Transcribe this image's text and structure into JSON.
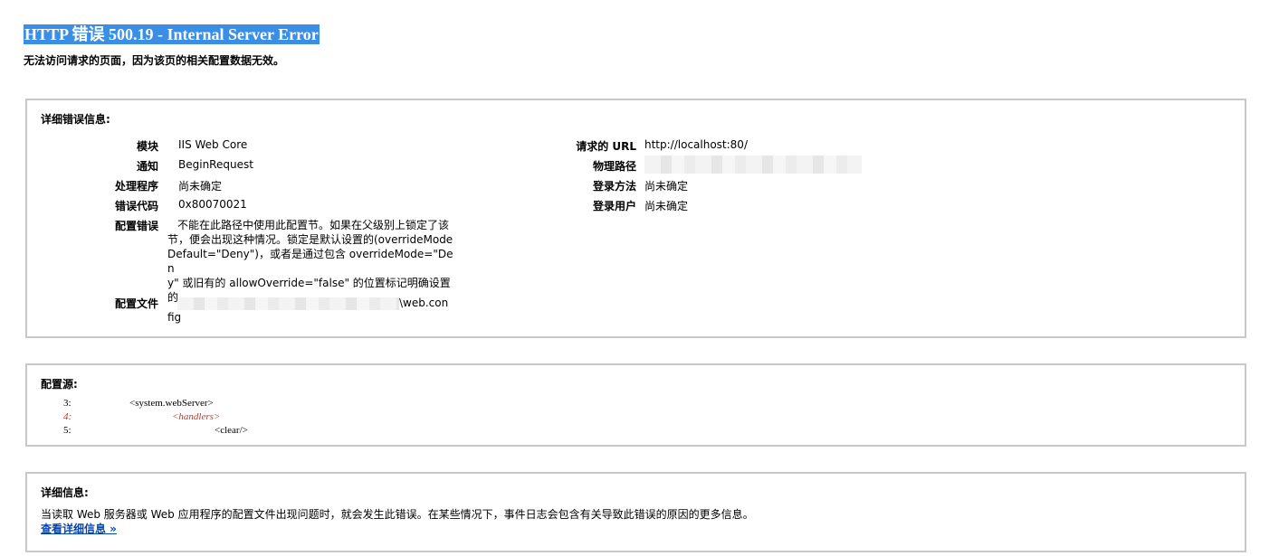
{
  "header": {
    "title": "HTTP 错误 500.19 - Internal Server Error",
    "subtitle": "无法访问请求的页面，因为该页的相关配置数据无效。"
  },
  "details": {
    "heading": "详细错误信息:",
    "left": [
      {
        "label": "模块",
        "value": "IIS Web Core"
      },
      {
        "label": "通知",
        "value": "BeginRequest"
      },
      {
        "label": "处理程序",
        "value": "尚未确定"
      },
      {
        "label": "错误代码",
        "value": "0x80070021"
      }
    ],
    "config_error": {
      "label": "配置错误",
      "lines": [
        "不能在此路径中使用此配置节。如果在父级别上锁定了该",
        "节，便会出现这种情况。锁定是默认设置的(overrideMode",
        "Default=\"Deny\")，或者是通过包含 overrideMode=\"Den",
        "y\" 或旧有的 allowOverride=\"false\" 的位置标记明确设置",
        "的。"
      ]
    },
    "config_file": {
      "label": "配置文件",
      "suffix": "\\web.con",
      "line2": "fig"
    },
    "right": [
      {
        "label": "请求的 URL",
        "value": "http://localhost:80/"
      },
      {
        "label": "物理路径",
        "value": ""
      },
      {
        "label": "登录方法",
        "value": "尚未确定"
      },
      {
        "label": "登录用户",
        "value": "尚未确定"
      }
    ]
  },
  "source": {
    "heading": "配置源:",
    "lines": [
      {
        "num": "3:",
        "text": "<system.webServer>",
        "indent": 0,
        "error": false
      },
      {
        "num": "4:",
        "text": "<handlers>",
        "indent": 1,
        "error": true
      },
      {
        "num": "5:",
        "text": "<clear/>",
        "indent": 2,
        "error": false
      }
    ]
  },
  "info": {
    "heading": "详细信息:",
    "text": "当读取 Web 服务器或 Web 应用程序的配置文件出现问题时，就会发生此错误。在某些情况下，事件日志会包含有关导致此错误的原因的更多信息。",
    "link": "查看详细信息 »"
  }
}
